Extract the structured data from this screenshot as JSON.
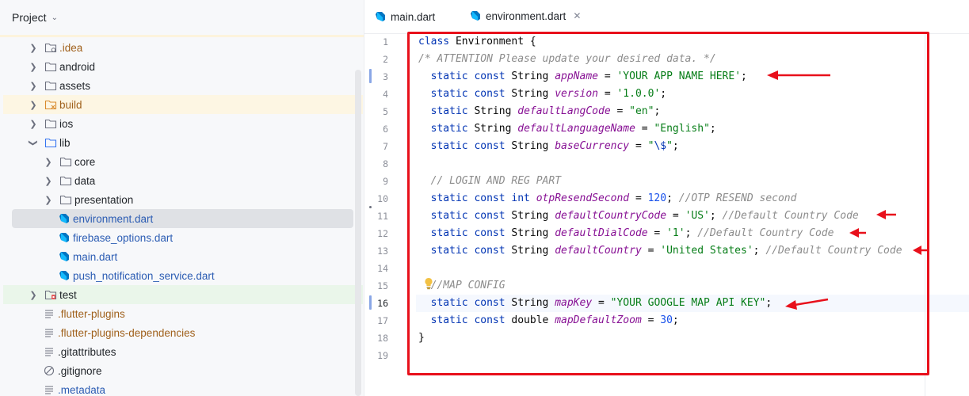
{
  "project_panel": {
    "title": "Project",
    "tree": [
      {
        "label": ".idea",
        "kind": "folder-config",
        "expandable": true,
        "color": "orange"
      },
      {
        "label": "android",
        "kind": "folder",
        "expandable": true
      },
      {
        "label": "assets",
        "kind": "folder",
        "expandable": true
      },
      {
        "label": "build",
        "kind": "folder-excluded",
        "expandable": true,
        "color": "orange"
      },
      {
        "label": "ios",
        "kind": "folder",
        "expandable": true
      },
      {
        "label": "lib",
        "kind": "folder-source",
        "expandable": true,
        "expanded": true
      },
      {
        "label": "core",
        "kind": "folder",
        "expandable": true
      },
      {
        "label": "data",
        "kind": "folder",
        "expandable": true
      },
      {
        "label": "presentation",
        "kind": "folder",
        "expandable": true
      },
      {
        "label": "environment.dart",
        "kind": "dart-file",
        "selected": true,
        "color": "blue"
      },
      {
        "label": "firebase_options.dart",
        "kind": "dart-file",
        "color": "blue"
      },
      {
        "label": "main.dart",
        "kind": "dart-file",
        "color": "blue"
      },
      {
        "label": "push_notification_service.dart",
        "kind": "dart-file",
        "color": "blue"
      },
      {
        "label": "test",
        "kind": "folder-test",
        "expandable": true
      },
      {
        "label": ".flutter-plugins",
        "kind": "text-file",
        "color": "orange"
      },
      {
        "label": ".flutter-plugins-dependencies",
        "kind": "text-file",
        "color": "orange"
      },
      {
        "label": ".gitattributes",
        "kind": "text-file"
      },
      {
        "label": ".gitignore",
        "kind": "ignore-file"
      },
      {
        "label": ".metadata",
        "kind": "text-file",
        "color": "blue"
      }
    ]
  },
  "editor": {
    "tabs": [
      {
        "label": "main.dart",
        "active": false
      },
      {
        "label": "environment.dart",
        "active": true
      }
    ],
    "line_numbers": [
      "1",
      "2",
      "3",
      "4",
      "5",
      "6",
      "7",
      "8",
      "9",
      "10",
      "11",
      "12",
      "13",
      "14",
      "15",
      "16",
      "17",
      "18",
      "19"
    ],
    "current_line": "16",
    "code": {
      "l1": {
        "kw": "class",
        "name": "Environment {"
      },
      "l2": {
        "comment": "/* ATTENTION Please update your desired data. */"
      },
      "l3": {
        "kw": "static const",
        "type": "String",
        "field": "appName",
        "eq": " = ",
        "value": "'YOUR APP NAME HERE'",
        "end": ";"
      },
      "l4": {
        "kw": "static const",
        "type": "String",
        "field": "version",
        "eq": " = ",
        "value": "'1.0.0'",
        "end": ";"
      },
      "l5": {
        "kw": "static",
        "type": "String",
        "field": "defaultLangCode",
        "eq": " = ",
        "value": "\"en\"",
        "end": ";"
      },
      "l6": {
        "kw": "static",
        "type": "String",
        "field": "defaultLanguageName",
        "eq": " = ",
        "value": "\"English\"",
        "end": ";"
      },
      "l7": {
        "kw": "static const",
        "type": "String",
        "field": "baseCurrency",
        "eq": " = ",
        "value_a": "\"",
        "value_esc": "\\$",
        "value_b": "\"",
        "end": ";"
      },
      "l9": {
        "comment": "// LOGIN AND REG PART"
      },
      "l10": {
        "kw": "static const",
        "type": "int",
        "field": "otpResendSecond",
        "eq": " = ",
        "value": "120",
        "end": "; ",
        "comment": "//OTP RESEND second"
      },
      "l11": {
        "kw": "static const",
        "type": "String",
        "field": "defaultCountryCode",
        "eq": " = ",
        "value": "'US'",
        "end": "; ",
        "comment": "//Default Country Code"
      },
      "l12": {
        "kw": "static const",
        "type": "String",
        "field": "defaultDialCode",
        "eq": " = ",
        "value": "'1'",
        "end": "; ",
        "comment": "//Default Country Code"
      },
      "l13": {
        "kw": "static const",
        "type": "String",
        "field": "defaultCountry",
        "eq": " = ",
        "value": "'United States'",
        "end": "; ",
        "comment": "//Default Country Code"
      },
      "l15": {
        "comment": "//MAP CONFIG"
      },
      "l16": {
        "kw": "static const",
        "type": "String",
        "field": "mapKey",
        "eq": " = ",
        "value": "\"YOUR GOOGLE MAP API KEY\"",
        "end": ";"
      },
      "l17": {
        "kw": "static const",
        "type": "double",
        "field": "mapDefaultZoom",
        "eq": " = ",
        "value": "30",
        "end": ";"
      },
      "l18": {
        "text": "}"
      }
    },
    "annotation_color": "#e8101b"
  }
}
